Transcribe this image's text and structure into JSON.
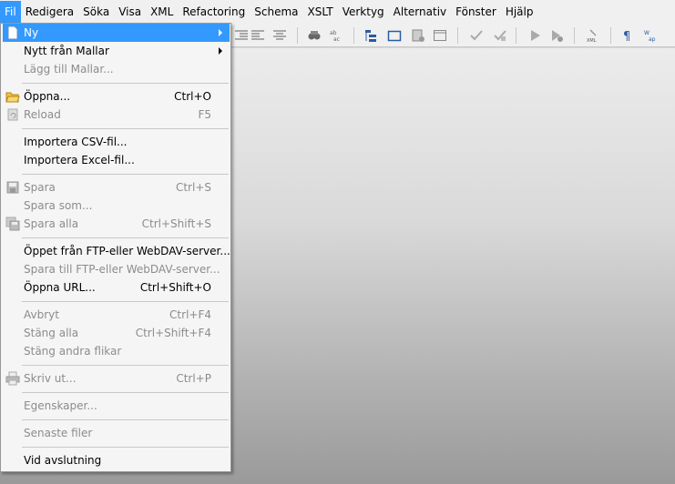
{
  "menubar": {
    "items": [
      "Fil",
      "Redigera",
      "Söka",
      "Visa",
      "XML",
      "Refactoring",
      "Schema",
      "XSLT",
      "Verktyg",
      "Alternativ",
      "Fönster",
      "Hjälp"
    ]
  },
  "file_menu": {
    "items": [
      {
        "label": "Ny",
        "shortcut": "",
        "submenu": true,
        "enabled": true,
        "highlighted": true,
        "icon": "new-document-icon"
      },
      {
        "label": "Nytt från Mallar",
        "shortcut": "",
        "submenu": true,
        "enabled": true
      },
      {
        "label": "Lägg till Mallar...",
        "shortcut": "",
        "enabled": false
      },
      {
        "label": "Öppna...",
        "shortcut": "Ctrl+O",
        "enabled": true,
        "icon": "open-folder-icon"
      },
      {
        "label": "Reload",
        "shortcut": "F5",
        "enabled": false,
        "icon": "reload-icon"
      },
      {
        "label": "Importera CSV-fil...",
        "shortcut": "",
        "enabled": true
      },
      {
        "label": "Importera Excel-fil...",
        "shortcut": "",
        "enabled": true
      },
      {
        "label": "Spara",
        "shortcut": "Ctrl+S",
        "enabled": false,
        "icon": "save-icon"
      },
      {
        "label": "Spara som...",
        "shortcut": "",
        "enabled": false
      },
      {
        "label": "Spara alla",
        "shortcut": "Ctrl+Shift+S",
        "enabled": false,
        "icon": "save-all-icon"
      },
      {
        "label": "Öppet från FTP-eller WebDAV-server...",
        "shortcut": "",
        "enabled": true
      },
      {
        "label": "Spara till FTP-eller WebDAV-server...",
        "shortcut": "",
        "enabled": false
      },
      {
        "label": "Öppna URL...",
        "shortcut": "Ctrl+Shift+O",
        "enabled": true
      },
      {
        "label": "Avbryt",
        "shortcut": "Ctrl+F4",
        "enabled": false
      },
      {
        "label": "Stäng alla",
        "shortcut": "Ctrl+Shift+F4",
        "enabled": false
      },
      {
        "label": "Stäng andra flikar",
        "shortcut": "",
        "enabled": false
      },
      {
        "label": "Skriv ut...",
        "shortcut": "Ctrl+P",
        "enabled": false,
        "icon": "print-icon"
      },
      {
        "label": "Egenskaper...",
        "shortcut": "",
        "enabled": false
      },
      {
        "label": "Senaste filer",
        "shortcut": "",
        "enabled": false
      },
      {
        "label": "Vid avslutning",
        "shortcut": "",
        "enabled": true
      }
    ]
  },
  "colors": {
    "highlight": "#3399ff",
    "menu_bg": "#f5f5f5",
    "disabled_text": "#8c8c8c"
  }
}
